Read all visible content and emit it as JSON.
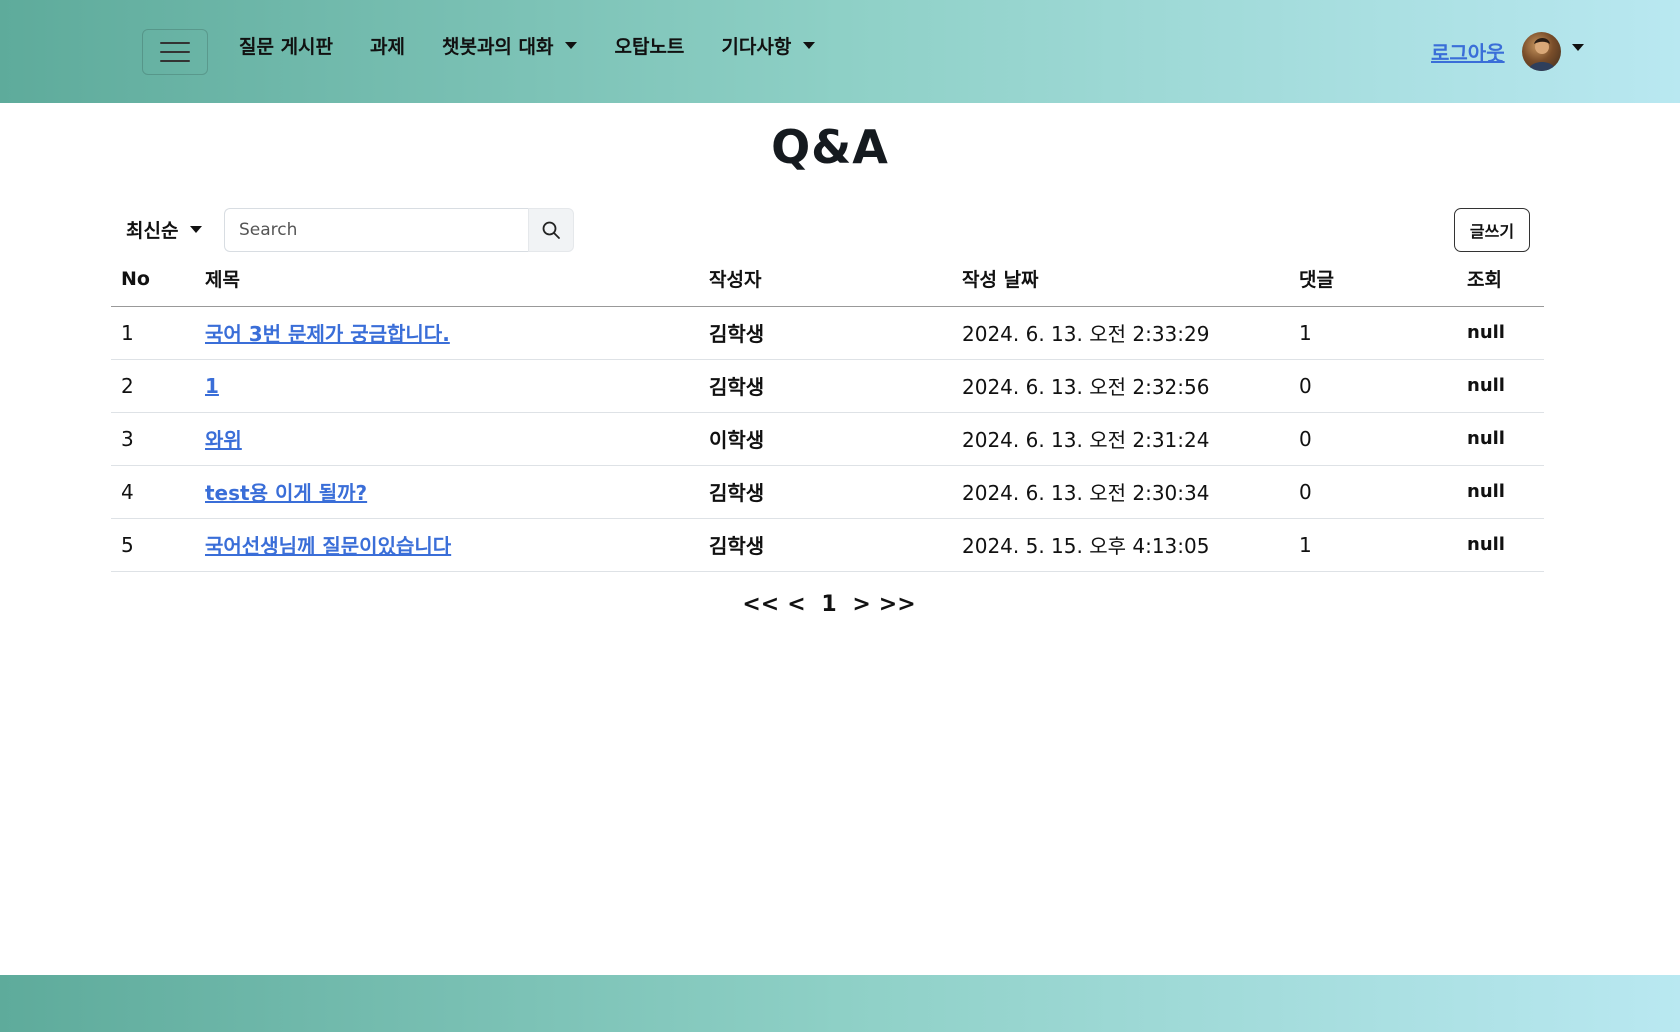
{
  "nav": {
    "items": [
      {
        "label": "질문 게시판",
        "has_dropdown": false
      },
      {
        "label": "과제",
        "has_dropdown": false
      },
      {
        "label": "챗봇과의 대화",
        "has_dropdown": true
      },
      {
        "label": "오탑노트",
        "has_dropdown": false
      },
      {
        "label": "기다사항",
        "has_dropdown": true
      }
    ],
    "logout_label": "로그아웃",
    "colors": {
      "gradient_start": "#5eab9b",
      "gradient_end": "#b9e8f1",
      "link": "#3a6ed8"
    }
  },
  "page": {
    "title": "Q&A"
  },
  "toolbar": {
    "sort_label": "최신순",
    "search_placeholder": "Search",
    "write_label": "글쓰기"
  },
  "table": {
    "headers": {
      "no": "No",
      "title": "제목",
      "author": "작성자",
      "date": "작성 날짜",
      "comments": "댓글",
      "views": "조회"
    },
    "rows": [
      {
        "no": "1",
        "title": "국어 3번 문제가 궁금합니다.",
        "author": "김학생",
        "date": "2024. 6. 13. 오전 2:33:29",
        "comments": "1",
        "views": "null"
      },
      {
        "no": "2",
        "title": "1",
        "author": "김학생",
        "date": "2024. 6. 13. 오전 2:32:56",
        "comments": "0",
        "views": "null"
      },
      {
        "no": "3",
        "title": "와위",
        "author": "이학생",
        "date": "2024. 6. 13. 오전 2:31:24",
        "comments": "0",
        "views": "null"
      },
      {
        "no": "4",
        "title": "test용 이게 될까?",
        "author": "김학생",
        "date": "2024. 6. 13. 오전 2:30:34",
        "comments": "0",
        "views": "null"
      },
      {
        "no": "5",
        "title": "국어선생님께 질문이있습니다",
        "author": "김학생",
        "date": "2024. 5. 15. 오후 4:13:05",
        "comments": "1",
        "views": "null"
      }
    ]
  },
  "pagination": {
    "first": "<<",
    "prev": "<",
    "current": "1",
    "next": ">",
    "last": ">>"
  }
}
